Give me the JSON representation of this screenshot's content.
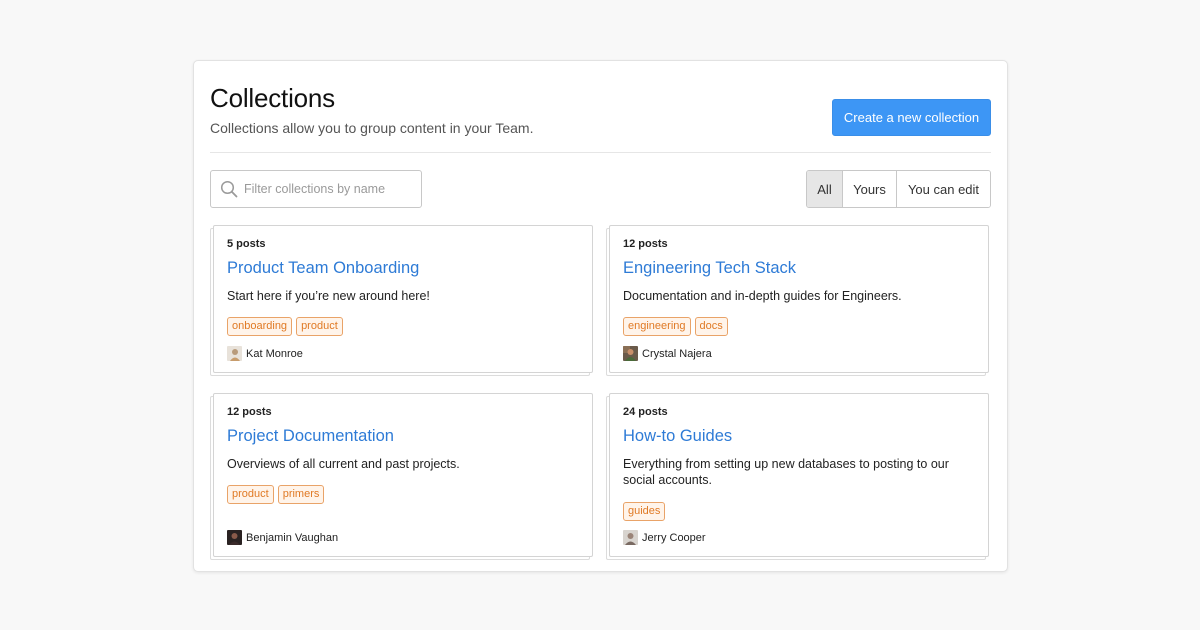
{
  "header": {
    "title": "Collections",
    "subtitle": "Collections allow you to group content in your Team.",
    "create_button": "Create a new collection"
  },
  "search": {
    "placeholder": "Filter collections by name",
    "icon": "search-icon"
  },
  "filters": {
    "options": [
      "All",
      "Yours",
      "You can edit"
    ],
    "selected": "All"
  },
  "colors": {
    "accent": "#3d96f5",
    "link": "#2e7bd6",
    "tag_text": "#e07a25",
    "tag_border": "#e9a368"
  },
  "collections": [
    {
      "posts": "5 posts",
      "title": "Product Team Onboarding",
      "description": "Start here if you’re new around here!",
      "tags": [
        "onboarding",
        "product"
      ],
      "author": "Kat Monroe"
    },
    {
      "posts": "12 posts",
      "title": "Engineering Tech Stack",
      "description": "Documentation and in-depth guides for Engineers.",
      "tags": [
        "engineering",
        "docs"
      ],
      "author": "Crystal Najera"
    },
    {
      "posts": "12 posts",
      "title": "Project Documentation",
      "description": "Overviews of all current and past projects.",
      "tags": [
        "product",
        "primers"
      ],
      "author": "Benjamin Vaughan"
    },
    {
      "posts": "24 posts",
      "title": "How-to Guides",
      "description": "Everything from setting up new databases to posting to our social accounts.",
      "tags": [
        "guides"
      ],
      "author": "Jerry Cooper"
    }
  ]
}
